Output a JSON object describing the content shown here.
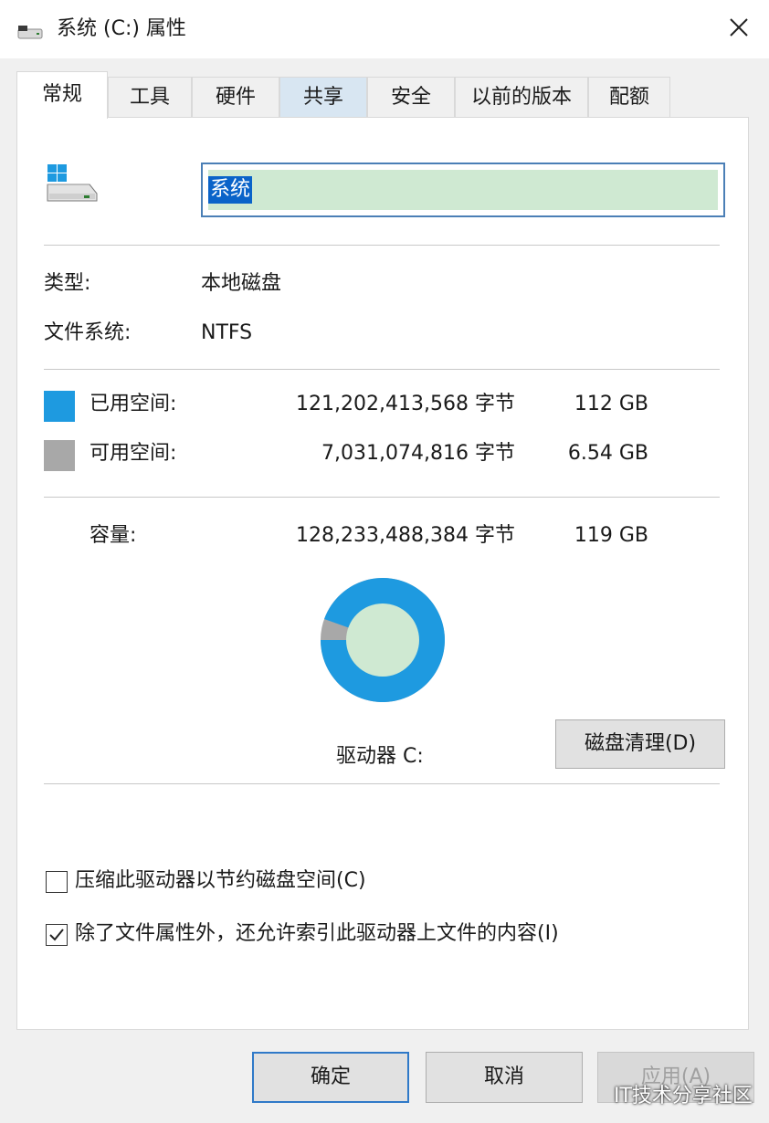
{
  "window": {
    "title": "系统 (C:) 属性",
    "close_glyph": "✕"
  },
  "tabs": [
    {
      "label": "常规",
      "active": true
    },
    {
      "label": "工具"
    },
    {
      "label": "硬件"
    },
    {
      "label": "共享",
      "hover": true
    },
    {
      "label": "安全"
    },
    {
      "label": "以前的版本"
    },
    {
      "label": "配额"
    }
  ],
  "drive": {
    "icon": "windows-drive-icon",
    "name_value": "系统"
  },
  "info": {
    "type_label": "类型:",
    "type_value": "本地磁盘",
    "fs_label": "文件系统:",
    "fs_value": "NTFS"
  },
  "space": {
    "used_label": "已用空间:",
    "used_bytes": "121,202,413,568 字节",
    "used_size": "112 GB",
    "used_color": "#1e9ae0",
    "free_label": "可用空间:",
    "free_bytes": "7,031,074,816 字节",
    "free_size": "6.54 GB",
    "free_color": "#a8a8a8",
    "capacity_label": "容量:",
    "capacity_bytes": "128,233,488,384 字节",
    "capacity_size": "119 GB",
    "drive_label": "驱动器 C:",
    "used_fraction": 0.945
  },
  "buttons": {
    "cleanup": "磁盘清理(D)",
    "ok": "确定",
    "cancel": "取消",
    "apply": "应用(A)"
  },
  "options": [
    {
      "label": "压缩此驱动器以节约磁盘空间(C)",
      "checked": false
    },
    {
      "label": "除了文件属性外，还允许索引此驱动器上文件的内容(I)",
      "checked": true
    }
  ],
  "watermark": "IT技术分享社区"
}
